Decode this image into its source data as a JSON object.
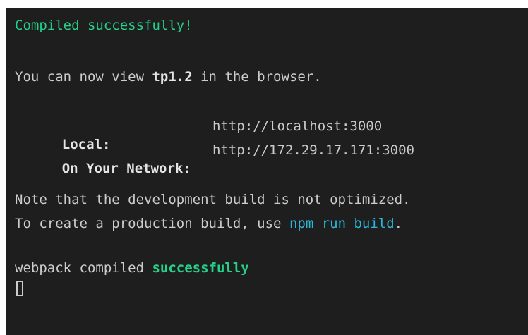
{
  "terminal": {
    "compiled_message": "Compiled successfully!",
    "view_prefix": "You can now view ",
    "app_name": "tp1.2",
    "view_suffix": " in the browser.",
    "local_label": "Local:",
    "local_url": "http://localhost:3000",
    "network_label": "On Your Network:",
    "network_url": "http://172.29.17.171:3000",
    "note_line": "Note that the development build is not optimized.",
    "build_prefix": "To create a production build, use ",
    "build_command": "npm run build",
    "build_suffix": ".",
    "webpack_prefix": "webpack compiled ",
    "webpack_status": "successfully"
  },
  "colors": {
    "background": "#1e1e1e",
    "text": "#cccccc",
    "success_green": "#23d18b",
    "command_cyan": "#29b8db"
  }
}
